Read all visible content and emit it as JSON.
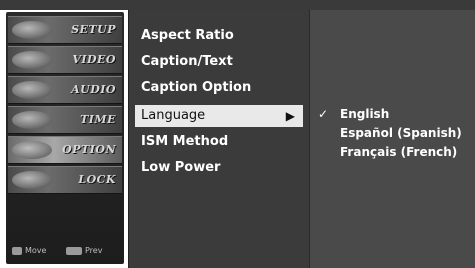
{
  "sidebar": {
    "items": [
      {
        "label": "SETUP"
      },
      {
        "label": "VIDEO"
      },
      {
        "label": "AUDIO"
      },
      {
        "label": "TIME"
      },
      {
        "label": "OPTION"
      },
      {
        "label": "LOCK"
      }
    ],
    "footer": {
      "move_label": "Move",
      "prev_label": "Prev"
    }
  },
  "menu": {
    "items": [
      {
        "label": "Aspect Ratio"
      },
      {
        "label": "Caption/Text"
      },
      {
        "label": "Caption Option"
      },
      {
        "label": "Language"
      },
      {
        "label": "ISM Method"
      },
      {
        "label": "Low Power"
      }
    ],
    "selected_index": 3,
    "submenu_arrow": "▶"
  },
  "submenu": {
    "items": [
      {
        "label": "English",
        "checked": true
      },
      {
        "label": "Español (Spanish)",
        "checked": false
      },
      {
        "label": "Français (French)",
        "checked": false
      }
    ],
    "check_glyph": "✓"
  },
  "colors": {
    "menu_bg": "#3b3b3b",
    "submenu_bg": "#4a4a4a",
    "highlight_bg": "#e9e9e9",
    "text": "#ffffff"
  }
}
